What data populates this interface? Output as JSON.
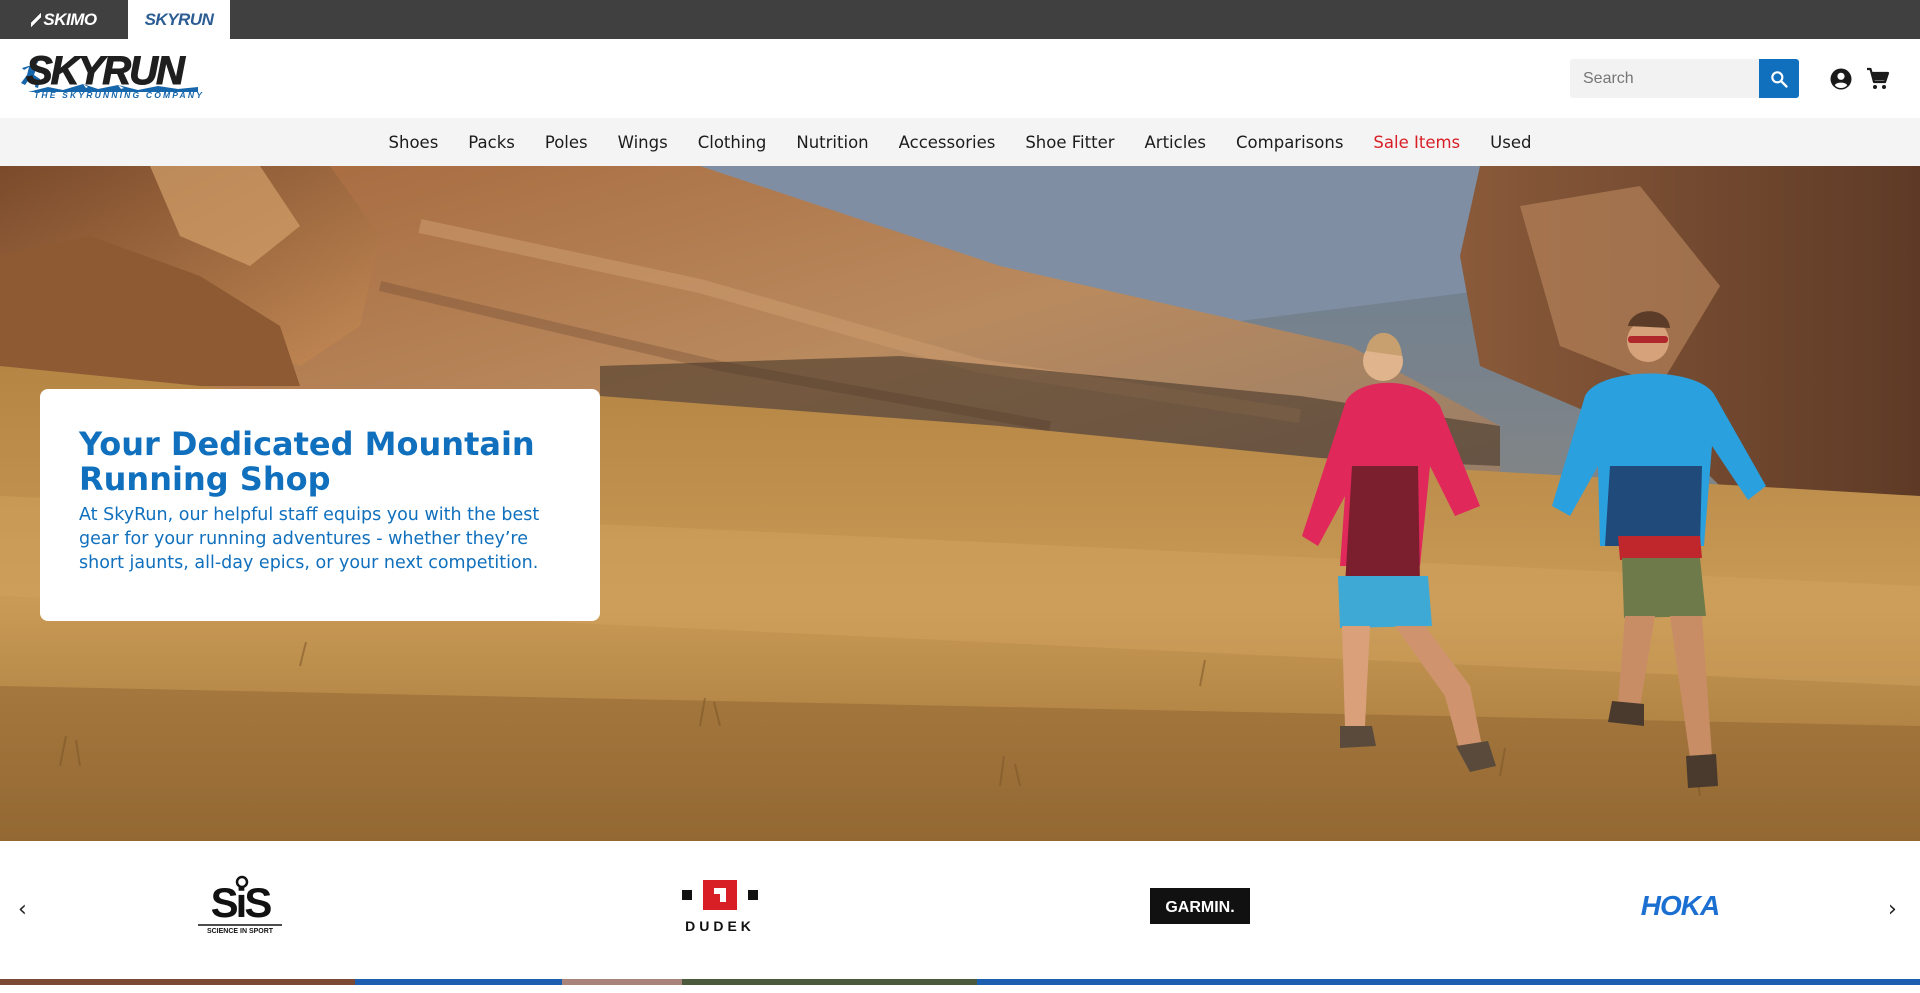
{
  "brand_tabs": [
    {
      "label": "SKIMO"
    },
    {
      "label": "SKYRUN"
    }
  ],
  "logo": {
    "word": "SKYRUN",
    "tagline": "THE SKYRUNNING COMPANY"
  },
  "search": {
    "placeholder": "Search"
  },
  "nav": [
    {
      "label": "Shoes"
    },
    {
      "label": "Packs"
    },
    {
      "label": "Poles"
    },
    {
      "label": "Wings"
    },
    {
      "label": "Clothing"
    },
    {
      "label": "Nutrition"
    },
    {
      "label": "Accessories"
    },
    {
      "label": "Shoe Fitter"
    },
    {
      "label": "Articles"
    },
    {
      "label": "Comparisons"
    },
    {
      "label": "Sale Items"
    },
    {
      "label": "Used"
    }
  ],
  "hero": {
    "title": "Your Dedicated Mountain Running Shop",
    "text": "At SkyRun, our helpful staff equips you with the best gear for your running adventures - whether they’re short jaunts, all-day epics, or your next competition."
  },
  "brands": {
    "prev_arrow": "‹",
    "next_arrow": "›",
    "items": [
      {
        "name": "SiS",
        "subtitle": "SCIENCE IN SPORT"
      },
      {
        "name": "DUDEK"
      },
      {
        "name": "GARMIN."
      },
      {
        "name": "HOKA"
      }
    ]
  },
  "colors": {
    "accent": "#1070bd",
    "sale": "#d81f26",
    "topbar": "#404040",
    "nav_bg": "#f4f4f4"
  }
}
